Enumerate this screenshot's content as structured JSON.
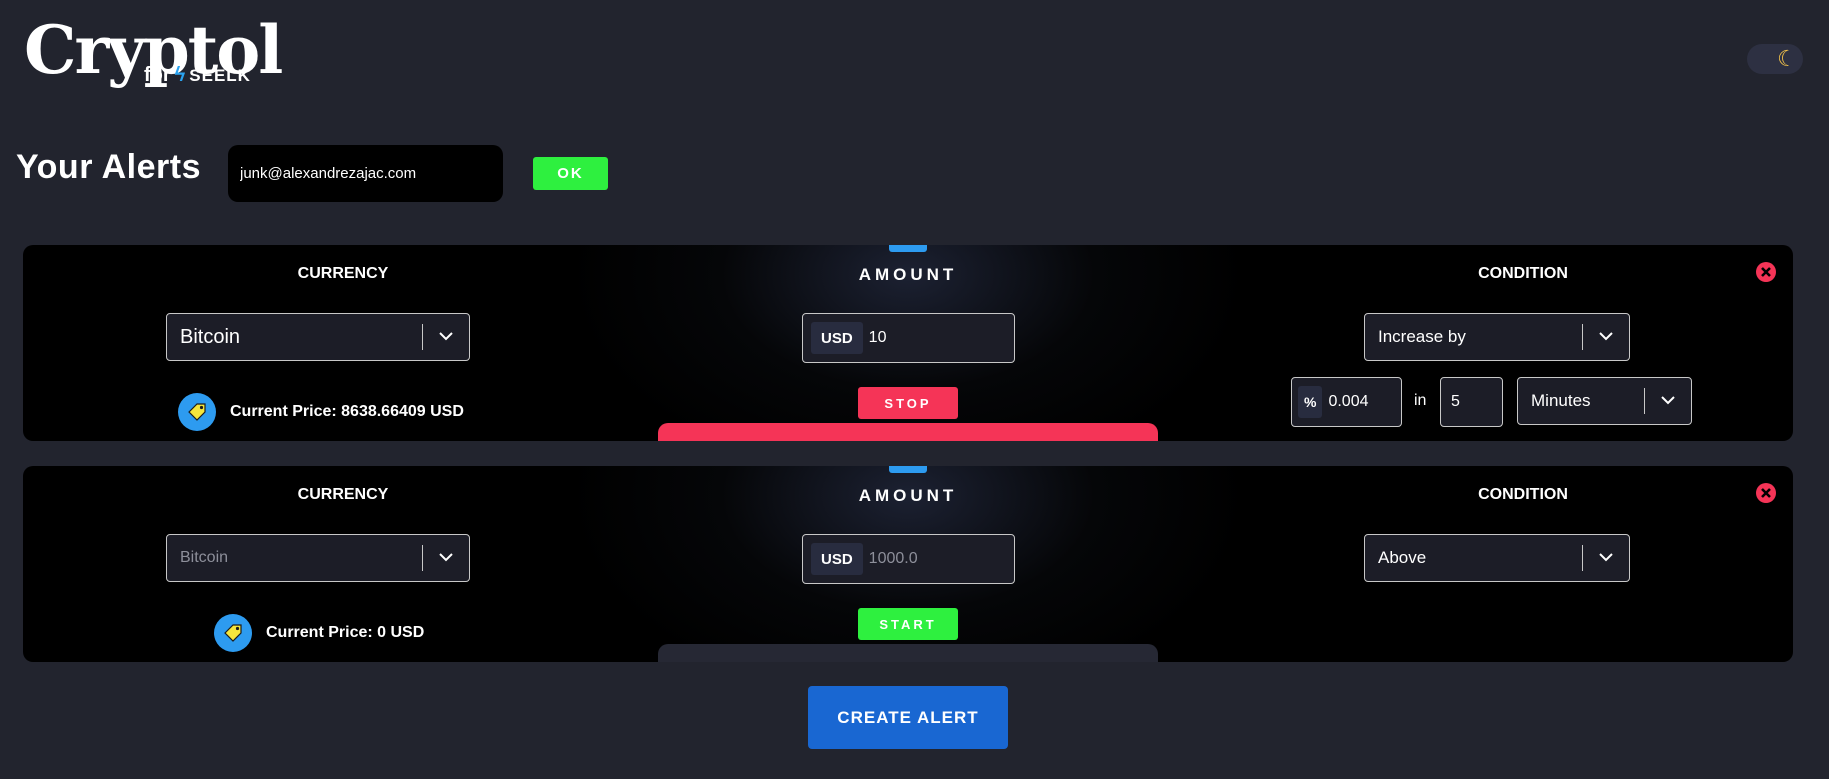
{
  "logo": {
    "title": "Cryptol",
    "for": "for",
    "brand": "SEELK"
  },
  "page": {
    "title": "Your Alerts"
  },
  "email": {
    "value": "junk@alexandrezajac.com"
  },
  "ok_label": "OK",
  "create_label": "CREATE ALERT",
  "alerts": [
    {
      "currency_label": "CURRENCY",
      "amount_label": "AMOUNT",
      "condition_label": "CONDITION",
      "currency": "Bitcoin",
      "amount_prefix": "USD",
      "amount_value": "10",
      "amount_placeholder": "",
      "price_text": "Current Price: 8638.66409 USD",
      "action_label": "STOP",
      "condition": "Increase by",
      "pct_prefix": "%",
      "pct_value": "0.004",
      "in_label": "in",
      "interval_value": "5",
      "unit": "Minutes"
    },
    {
      "currency_label": "CURRENCY",
      "amount_label": "AMOUNT",
      "condition_label": "CONDITION",
      "currency": "Bitcoin",
      "amount_prefix": "USD",
      "amount_value": "",
      "amount_placeholder": "1000.0",
      "price_text": "Current Price: 0 USD",
      "action_label": "START",
      "condition": "Above"
    }
  ],
  "colors": {
    "background": "#22242e",
    "card": "#000000",
    "accent_blue": "#2d9bf0",
    "stop_red": "#f53457",
    "start_green": "#2ef03f",
    "create_blue": "#1967d2"
  },
  "icons": [
    "moon-icon",
    "tag-icon",
    "close-icon",
    "chevron-down-icon",
    "bolt-icon"
  ]
}
